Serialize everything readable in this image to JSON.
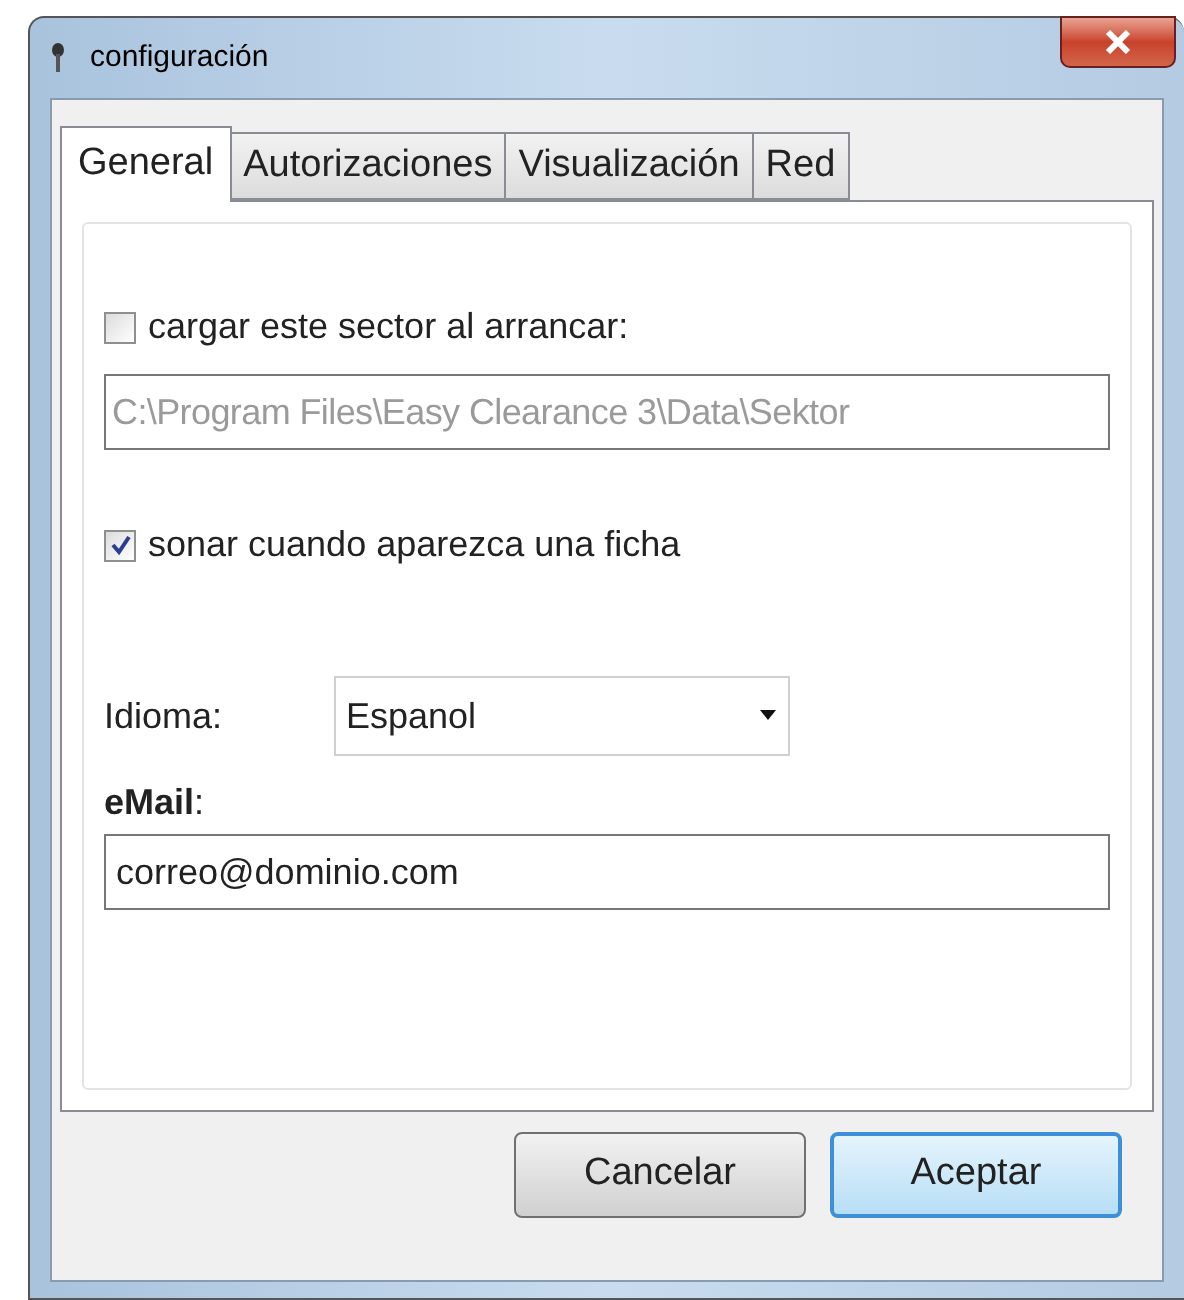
{
  "window": {
    "title": "configuración"
  },
  "tabs": [
    {
      "label": "General",
      "selected": true
    },
    {
      "label": "Autorizaciones",
      "selected": false
    },
    {
      "label": "Visualización",
      "selected": false
    },
    {
      "label": "Red",
      "selected": false
    }
  ],
  "load_sector": {
    "label": "cargar este sector al arrancar:",
    "checked": false,
    "path": "C:\\Program Files\\Easy Clearance 3\\Data\\Sektor",
    "disabled": true
  },
  "sound": {
    "label": "sonar cuando aparezca una ficha",
    "checked": true
  },
  "language": {
    "label": "Idioma:",
    "value": "Espanol"
  },
  "email": {
    "label": "**eMail**:",
    "value": "correo@dominio.com"
  },
  "buttons": [
    {
      "label": "Cancelar",
      "default": false
    },
    {
      "label": "Aceptar",
      "default": true
    }
  ]
}
